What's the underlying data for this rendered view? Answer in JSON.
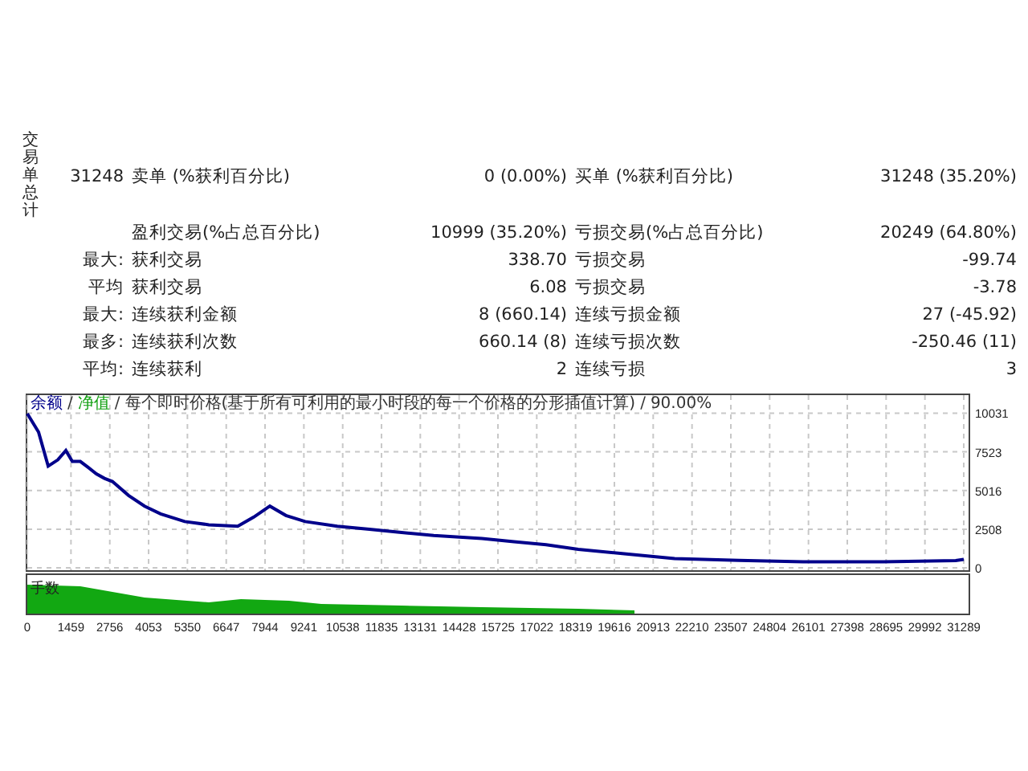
{
  "summary": {
    "vertical_label": "交易单总计",
    "total": "31248",
    "sell_label": "卖单 (%获利百分比)",
    "sell_value": "0 (0.00%)",
    "buy_label": "买单 (%获利百分比)",
    "buy_value": "31248 (35.20%)"
  },
  "rows": [
    {
      "prefix": "",
      "left_label": "盈利交易(%占总百分比)",
      "left_value": "10999 (35.20%)",
      "right_label": "亏损交易(%占总百分比)",
      "right_value": "20249 (64.80%)"
    },
    {
      "prefix": "最大:",
      "left_label": "获利交易",
      "left_value": "338.70",
      "right_label": "亏损交易",
      "right_value": "-99.74"
    },
    {
      "prefix": "平均",
      "left_label": "获利交易",
      "left_value": "6.08",
      "right_label": "亏损交易",
      "right_value": "-3.78"
    },
    {
      "prefix": "最大:",
      "left_label": "连续获利金额",
      "left_value": "8 (660.14)",
      "right_label": "连续亏损金额",
      "right_value": "27 (-45.92)"
    },
    {
      "prefix": "最多:",
      "left_label": "连续获利次数",
      "left_value": "660.14 (8)",
      "right_label": "连续亏损次数",
      "right_value": "-250.46 (11)"
    },
    {
      "prefix": "平均:",
      "left_label": "连续获利",
      "left_value": "2",
      "right_label": "连续亏损",
      "right_value": "3"
    }
  ],
  "chart": {
    "legend": [
      {
        "text": "/",
        "color": "#333333"
      },
      {
        "text": "净值",
        "color": "#10a010"
      },
      {
        "text": "/",
        "color": "#333333"
      },
      {
        "text": "每个即时价格(基于所有可利用的最小时段的每一个价格的分形插值计算)",
        "color": "#333333"
      },
      {
        "text": "/",
        "color": "#333333"
      },
      {
        "text": "90.00%",
        "color": "#333333"
      }
    ],
    "volume_label": "手数",
    "chart_data": {
      "type": "line",
      "x": [
        0,
        376,
        698,
        1020,
        1288,
        1503,
        1771,
        2039,
        2308,
        2576,
        2844,
        3381,
        3917,
        4454,
        5260,
        6065,
        7031,
        7568,
        8104,
        8641,
        9285,
        10358,
        11432,
        12505,
        13579,
        15189,
        16262,
        17336,
        18409,
        20019,
        21629,
        23776,
        25922,
        28606,
        31021,
        31289
      ],
      "series": [
        {
          "name": "余额",
          "color": "#00008b",
          "values": [
            10000,
            8800,
            6600,
            7000,
            7600,
            6900,
            6900,
            6500,
            6100,
            5800,
            5600,
            4700,
            4000,
            3500,
            3000,
            2800,
            2700,
            3300,
            4000,
            3400,
            3000,
            2700,
            2500,
            2300,
            2100,
            1900,
            1700,
            1500,
            1200,
            900,
            600,
            490,
            400,
            400,
            470,
            550
          ]
        }
      ],
      "grid": true,
      "xlim": [
        0,
        31289
      ],
      "ylim": [
        -150,
        11300
      ],
      "yticks": [
        0,
        2508,
        5016,
        7523,
        10031
      ],
      "xticks": [
        0,
        1459,
        2756,
        4053,
        5350,
        6647,
        7944,
        9241,
        10538,
        11835,
        13131,
        14428,
        15725,
        17022,
        18319,
        19616,
        20913,
        22210,
        23507,
        24804,
        26101,
        27398,
        28695,
        29992,
        31289
      ]
    }
  }
}
